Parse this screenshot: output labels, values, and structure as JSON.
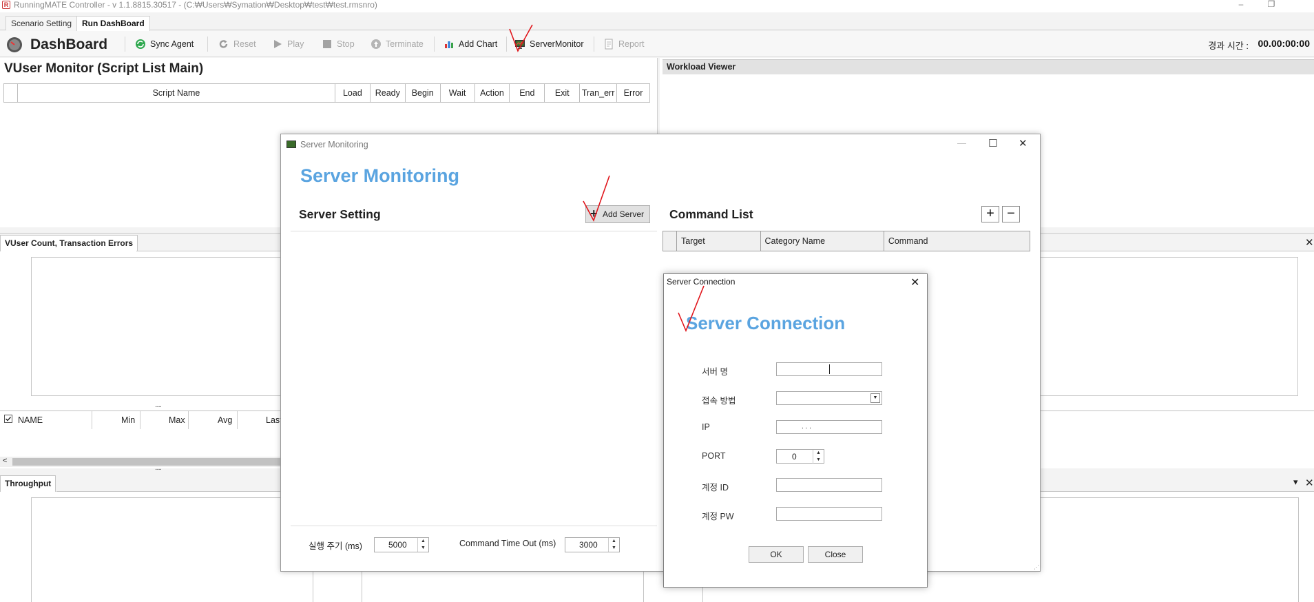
{
  "window": {
    "title": "RunningMATE Controller - v 1.1.8815.30517 - (C:₩Users₩Symation₩Desktop₩test₩test.rmsnro)",
    "controls": [
      "–",
      "❐"
    ]
  },
  "doc_tabs": [
    "Scenario Setting",
    "Run DashBoard"
  ],
  "toolbar": {
    "title": "DashBoard",
    "items": [
      {
        "label": "Sync Agent",
        "icon": "sync-icon"
      },
      {
        "label": "Reset",
        "icon": "reset-icon"
      },
      {
        "label": "Play",
        "icon": "play-icon"
      },
      {
        "label": "Stop",
        "icon": "stop-icon"
      },
      {
        "label": "Terminate",
        "icon": "terminate-icon"
      },
      {
        "label": "Add Chart",
        "icon": "chart-icon"
      },
      {
        "label": "ServerMonitor",
        "icon": "monitor-icon"
      },
      {
        "label": "Report",
        "icon": "report-icon"
      }
    ],
    "elapsed_label": "경과 시간 :",
    "elapsed_value": "00.00:00:00"
  },
  "vuser_monitor": {
    "title": "VUser Monitor (Script List Main)",
    "columns": [
      "Script Name",
      "Load",
      "Ready",
      "Begin",
      "Wait",
      "Action",
      "End",
      "Exit",
      "Tran_err",
      "Error"
    ]
  },
  "workload_viewer": {
    "title": "Workload Viewer"
  },
  "vuser_count": {
    "tab": "VUser Count, Transaction Errors",
    "close": "✕"
  },
  "splitter": ".....",
  "name_grid": {
    "columns": [
      "NAME",
      "Min",
      "Max",
      "Avg",
      "Last"
    ],
    "scroll_left": "<"
  },
  "throughput": {
    "tab": "Throughput",
    "pin": "▾",
    "close": "✕"
  },
  "server_monitoring": {
    "window_title": "Server Monitoring",
    "heading": "Server Monitoring",
    "server_setting": "Server Setting",
    "add_server": "Add Server",
    "command_list": "Command List",
    "add": "+",
    "remove": "−",
    "command_columns": [
      "Target",
      "Category Name",
      "Command"
    ],
    "interval_label": "실행 주기 (ms)",
    "interval_value": "5000",
    "timeout_label": "Command Time Out (ms)",
    "timeout_value": "3000",
    "controls": [
      "—",
      "☐",
      "✕"
    ]
  },
  "server_connection": {
    "window_title": "Server Connection",
    "heading": "Server Connection",
    "close": "✕",
    "fields": {
      "server_name": {
        "label": "서버 명",
        "value": ""
      },
      "method": {
        "label": "접속 방법",
        "value": ""
      },
      "ip": {
        "label": "IP",
        "value": ".          .          ."
      },
      "port": {
        "label": "PORT",
        "value": "0"
      },
      "account_id": {
        "label": "계정 ID",
        "value": ""
      },
      "account_pw": {
        "label": "계정 PW",
        "value": ""
      }
    },
    "ok": "OK",
    "cancel": "Close"
  },
  "colors": {
    "accent_blue": "#5aa4e0",
    "annotation_red": "#e0151b"
  }
}
